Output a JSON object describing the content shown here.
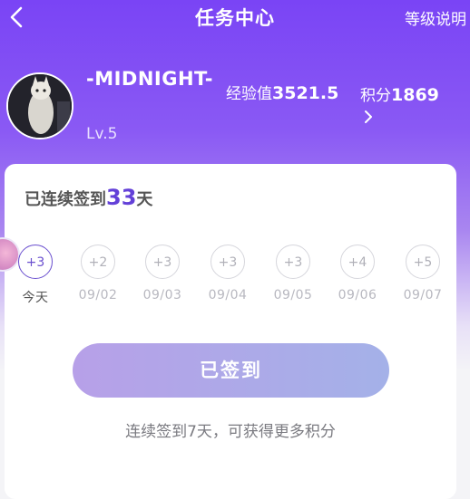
{
  "nav": {
    "title": "任务中心",
    "right_link": "等级说明"
  },
  "user": {
    "name": "-MIDNIGHT-",
    "level": "Lv.5",
    "exp_label": "经验值",
    "exp_value": "3521.5",
    "points_label": "积分",
    "points_value": "1869"
  },
  "checkin": {
    "streak_prefix": "已连续签到",
    "streak_days": "33",
    "streak_suffix": "天",
    "days": [
      {
        "reward": "+3",
        "label": "今天",
        "today": true
      },
      {
        "reward": "+2",
        "label": "09/02",
        "today": false
      },
      {
        "reward": "+3",
        "label": "09/03",
        "today": false
      },
      {
        "reward": "+3",
        "label": "09/04",
        "today": false
      },
      {
        "reward": "+3",
        "label": "09/05",
        "today": false
      },
      {
        "reward": "+4",
        "label": "09/06",
        "today": false
      },
      {
        "reward": "+5",
        "label": "09/07",
        "today": false
      }
    ],
    "button_label": "已签到",
    "hint": "连续签到7天，可获得更多积分"
  },
  "colors": {
    "header_purple": "#7a44f5",
    "accent": "#6340d8",
    "button_gradient_start": "#b7a0e8",
    "button_gradient_end": "#a4b1e8"
  },
  "icons": {
    "back": "chevron-left-icon",
    "more": "chevron-right-icon"
  }
}
